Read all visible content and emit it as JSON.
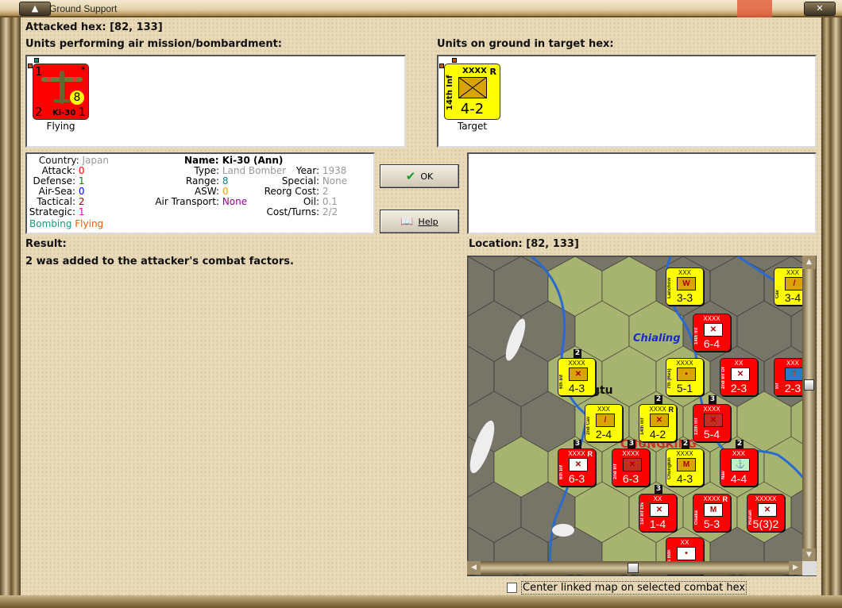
{
  "window": {
    "title": "Ground Support"
  },
  "header": {
    "attacked_hex": "Attacked hex:  [82, 133]"
  },
  "attackers": {
    "label": "Units performing air mission/bombardment:",
    "units": [
      {
        "name": "Ki-30",
        "top_left": "1",
        "bottom_left": "2",
        "bottom_right": "1",
        "range": "8",
        "star": "*",
        "status": "Flying",
        "color": "#ff0000"
      }
    ]
  },
  "defenders": {
    "label": "Units on ground in target hex:",
    "units": [
      {
        "name": "14th Inf",
        "size": "XXXX",
        "reserve": "R",
        "strength": "4-2",
        "status": "Target",
        "color": "#ffff00"
      }
    ]
  },
  "info": {
    "country": {
      "label": "Country:",
      "value": "Japan"
    },
    "attack": {
      "label": "Attack:",
      "value": "0"
    },
    "defense": {
      "label": "Defense:",
      "value": "1"
    },
    "air_sea": {
      "label": "Air-Sea:",
      "value": "0"
    },
    "tactical": {
      "label": "Tactical:",
      "value": "2"
    },
    "strategic": {
      "label": "Strategic:",
      "value": "1"
    },
    "tag1": "Bombing",
    "tag2": "Flying",
    "name": "Name: Ki-30 (Ann)",
    "type": {
      "label": "Type:",
      "value": "Land Bomber"
    },
    "range": {
      "label": "Range:",
      "value": "8"
    },
    "asw": {
      "label": "ASW:",
      "value": "0"
    },
    "air_transport": {
      "label": "Air Transport:",
      "value": "None"
    },
    "year": {
      "label": "Year:",
      "value": "1938"
    },
    "special": {
      "label": "Special:",
      "value": "None"
    },
    "reorg": {
      "label": "Reorg Cost:",
      "value": "2"
    },
    "oil": {
      "label": "Oil:",
      "value": "0.1"
    },
    "cost": {
      "label": "Cost/Turns:",
      "value": "2/2"
    }
  },
  "buttons": {
    "ok": "OK",
    "help": "Help"
  },
  "result": {
    "label": "Result:",
    "text": "2 was added to the attacker's combat factors."
  },
  "location": {
    "label": "Location:  [82, 133]"
  },
  "map": {
    "labels": {
      "city1": "Chialing",
      "city2": "ngtu",
      "city3": "CHUNGKING"
    },
    "units": [
      {
        "side": "jp",
        "size": "XXX",
        "name": "Lanchow Wkl",
        "sym": "W",
        "strength": "3-3"
      },
      {
        "side": "jp",
        "size": "XXX",
        "name": "Cav",
        "sym": "/",
        "strength": "3-4"
      },
      {
        "side": "cn",
        "size": "XXXX",
        "name": "14th Inf",
        "sym": "X",
        "strength": "6-4"
      },
      {
        "side": "jp",
        "size": "XXXX",
        "name": "6th Inf",
        "sym": "X",
        "strength": "4-3",
        "stack": "2"
      },
      {
        "side": "jp",
        "size": "XXXX",
        "name": "7th (Res)",
        "sym": "•",
        "strength": "5-1"
      },
      {
        "side": "cn",
        "size": "XX",
        "name": "2nd Inf Div",
        "sym": "X",
        "strength": "2-3"
      },
      {
        "side": "cn",
        "size": "XXX",
        "name": "Inf",
        "sym": "T",
        "strength": "2-3"
      },
      {
        "side": "jp",
        "size": "XXX",
        "name": "2nd Cav",
        "sym": "/",
        "strength": "2-4"
      },
      {
        "side": "jp",
        "size": "XXXX",
        "name": "14th Inf",
        "sym": "X",
        "strength": "4-2",
        "reserve": "R",
        "stack": "2"
      },
      {
        "side": "cn",
        "size": "XXXX",
        "name": "12th Inf",
        "sym": "X",
        "strength": "5-4",
        "stack": "3"
      },
      {
        "side": "cn",
        "size": "XXXX",
        "name": "6th Inf",
        "sym": "X",
        "strength": "6-3",
        "reserve": "R",
        "stack": "3"
      },
      {
        "side": "cn",
        "size": "XXXX",
        "name": "2nd Inf",
        "sym": "X",
        "strength": "6-3",
        "stack": "3"
      },
      {
        "side": "jp",
        "size": "XXXX",
        "name": "Chungking",
        "sym": "M",
        "strength": "4-3",
        "stack": "2"
      },
      {
        "side": "cn",
        "size": "XXX",
        "name": "Nav",
        "sym": "⚓",
        "strength": "4-4",
        "stack": "2"
      },
      {
        "side": "cn",
        "size": "XX",
        "name": "1st Inf Div",
        "sym": "X",
        "strength": "1-4",
        "stack": "3"
      },
      {
        "side": "cn",
        "size": "XXXX",
        "name": "Osaka",
        "sym": "M",
        "strength": "5-3",
        "reserve": "R"
      },
      {
        "side": "cn",
        "size": "XXXXX",
        "name": "Hunan",
        "sym": "X",
        "strength": "5(3)2"
      },
      {
        "side": "cn",
        "size": "XX",
        "name": "Res mtn",
        "sym": "•",
        "strength": ""
      }
    ]
  },
  "colors": {
    "japan": "#ffff00",
    "china": "#ff0000"
  },
  "checkbox": {
    "label": "Center linked map on selected combat hex",
    "checked": false
  }
}
